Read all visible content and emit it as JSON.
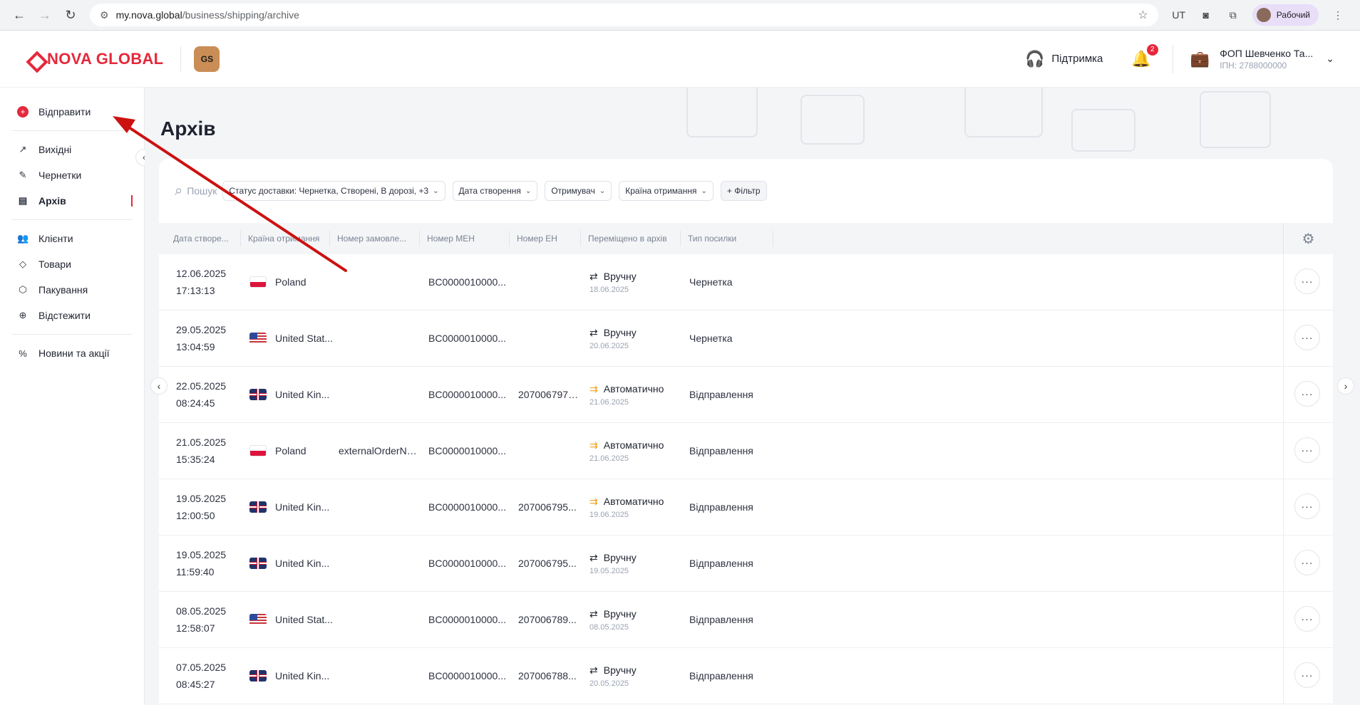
{
  "browser": {
    "url_host": "my.nova.global",
    "url_path": "/business/shipping/archive",
    "profile_label": "Рабочий"
  },
  "header": {
    "logo_text": "NOVA GLOBAL",
    "badge_text": "GS",
    "support_label": "Підтримка",
    "notifications_count": "2",
    "account_name": "ФОП Шевченко Та...",
    "account_tax": "ІПН: 2788000000"
  },
  "sidebar": {
    "send_label": "Відправити",
    "items": [
      {
        "label": "Вихідні"
      },
      {
        "label": "Чернетки"
      },
      {
        "label": "Архів"
      },
      {
        "label": "Клієнти"
      },
      {
        "label": "Товари"
      },
      {
        "label": "Пакування"
      },
      {
        "label": "Відстежити"
      },
      {
        "label": "Новини та акції"
      }
    ]
  },
  "page": {
    "title": "Архів",
    "search_placeholder": "Пошук",
    "filters": [
      "Статус доставки: Чернетка, Створені, В дорозі, +3",
      "Дата створення",
      "Отримувач",
      "Країна отримання"
    ],
    "add_filter_label": "+ Фільтр"
  },
  "table": {
    "columns": [
      "Дата створе...",
      "Країна отримання",
      "Номер замовле...",
      "Номер МЕН",
      "Номер ЕН",
      "Переміщено в архів",
      "Тип посилки"
    ],
    "rows": [
      {
        "date": "12.06.2025",
        "time": "17:13:13",
        "flag": "pl",
        "country": "Poland",
        "order": "",
        "men": "BC0000010000...",
        "en": "",
        "moved_type": "Вручну",
        "moved_auto": false,
        "moved_date": "18.06.2025",
        "parcel_type": "Чернетка"
      },
      {
        "date": "29.05.2025",
        "time": "13:04:59",
        "flag": "us",
        "country": "United Stat...",
        "order": "",
        "men": "BC0000010000...",
        "en": "",
        "moved_type": "Вручну",
        "moved_auto": false,
        "moved_date": "20.06.2025",
        "parcel_type": "Чернетка"
      },
      {
        "date": "22.05.2025",
        "time": "08:24:45",
        "flag": "gb",
        "country": "United Kin...",
        "order": "",
        "men": "BC0000010000...",
        "en": "2070067977...",
        "moved_type": "Автоматично",
        "moved_auto": true,
        "moved_date": "21.06.2025",
        "parcel_type": "Відправлення"
      },
      {
        "date": "21.05.2025",
        "time": "15:35:24",
        "flag": "pl",
        "country": "Poland",
        "order": "externalOrderNu...",
        "men": "BC0000010000...",
        "en": "",
        "moved_type": "Автоматично",
        "moved_auto": true,
        "moved_date": "21.06.2025",
        "parcel_type": "Відправлення"
      },
      {
        "date": "19.05.2025",
        "time": "12:00:50",
        "flag": "gb",
        "country": "United Kin...",
        "order": "",
        "men": "BC0000010000...",
        "en": "207006795...",
        "moved_type": "Автоматично",
        "moved_auto": true,
        "moved_date": "19.06.2025",
        "parcel_type": "Відправлення"
      },
      {
        "date": "19.05.2025",
        "time": "11:59:40",
        "flag": "gb",
        "country": "United Kin...",
        "order": "",
        "men": "BC0000010000...",
        "en": "207006795...",
        "moved_type": "Вручну",
        "moved_auto": false,
        "moved_date": "19.05.2025",
        "parcel_type": "Відправлення"
      },
      {
        "date": "08.05.2025",
        "time": "12:58:07",
        "flag": "us",
        "country": "United Stat...",
        "order": "",
        "men": "BC0000010000...",
        "en": "207006789...",
        "moved_type": "Вручну",
        "moved_auto": false,
        "moved_date": "08.05.2025",
        "parcel_type": "Відправлення"
      },
      {
        "date": "07.05.2025",
        "time": "08:45:27",
        "flag": "gb",
        "country": "United Kin...",
        "order": "",
        "men": "BC0000010000...",
        "en": "207006788...",
        "moved_type": "Вручну",
        "moved_auto": false,
        "moved_date": "20.05.2025",
        "parcel_type": "Відправлення"
      }
    ]
  },
  "colors": {
    "brand_red": "#e6283b",
    "auto_orange": "#f2a01a",
    "annotation_arrow": "#cc1111"
  }
}
